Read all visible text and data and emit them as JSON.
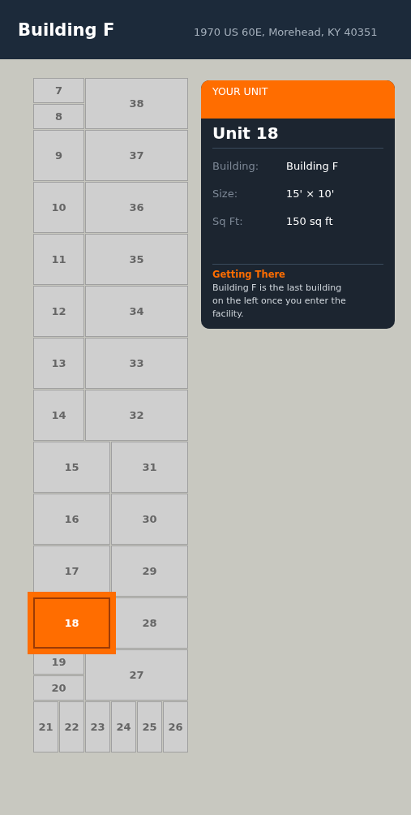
{
  "header": {
    "title": "Building F",
    "address": "1970 US 60E, Morehead, KY 40351"
  },
  "units": [
    {
      "label": "7",
      "selected": false
    },
    {
      "label": "8",
      "selected": false
    },
    {
      "label": "38",
      "selected": false
    },
    {
      "label": "9",
      "selected": false
    },
    {
      "label": "37",
      "selected": false
    },
    {
      "label": "10",
      "selected": false
    },
    {
      "label": "36",
      "selected": false
    },
    {
      "label": "11",
      "selected": false
    },
    {
      "label": "35",
      "selected": false
    },
    {
      "label": "12",
      "selected": false
    },
    {
      "label": "34",
      "selected": false
    },
    {
      "label": "13",
      "selected": false
    },
    {
      "label": "33",
      "selected": false
    },
    {
      "label": "14",
      "selected": false
    },
    {
      "label": "32",
      "selected": false
    },
    {
      "label": "15",
      "selected": false
    },
    {
      "label": "31",
      "selected": false
    },
    {
      "label": "16",
      "selected": false
    },
    {
      "label": "30",
      "selected": false
    },
    {
      "label": "17",
      "selected": false
    },
    {
      "label": "29",
      "selected": false
    },
    {
      "label": "18",
      "selected": true
    },
    {
      "label": "28",
      "selected": false
    },
    {
      "label": "19",
      "selected": false
    },
    {
      "label": "20",
      "selected": false
    },
    {
      "label": "27",
      "selected": false
    },
    {
      "label": "21",
      "selected": false
    },
    {
      "label": "22",
      "selected": false
    },
    {
      "label": "23",
      "selected": false
    },
    {
      "label": "24",
      "selected": false
    },
    {
      "label": "25",
      "selected": false
    },
    {
      "label": "26",
      "selected": false
    }
  ],
  "card": {
    "banner": "YOUR UNIT",
    "title": "Unit 18",
    "details": [
      {
        "label": "Building:",
        "value": "Building F"
      },
      {
        "label": "Size:",
        "value": "15' × 10'"
      },
      {
        "label": "Sq Ft:",
        "value": "150 sq ft"
      }
    ],
    "directions_title": "Getting There",
    "directions": "Building F is the last building on the left once you enter the facility."
  }
}
